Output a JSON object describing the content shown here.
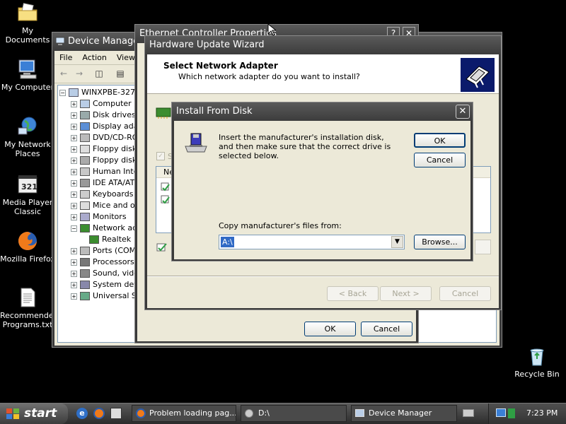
{
  "desktop": {
    "icons": [
      {
        "label": "My Documents"
      },
      {
        "label": "My Computer"
      },
      {
        "label": "My Network Places"
      },
      {
        "label": "Media Player Classic"
      },
      {
        "label": "Mozilla Firefox"
      },
      {
        "label": "Recommended Programs.txt"
      },
      {
        "label": "Recycle Bin"
      }
    ]
  },
  "device_manager": {
    "title": "Device Manager",
    "menu": [
      "File",
      "Action",
      "View"
    ],
    "root": "WINXPBE-327",
    "tree": [
      "Computer",
      "Disk drives",
      "Display ada",
      "DVD/CD-RO",
      "Floppy disk",
      "Floppy disk",
      "Human Inte",
      "IDE ATA/AT",
      "Keyboards",
      "Mice and ot",
      "Monitors",
      "Network ac",
      "Realtek",
      "Ports (COM",
      "Processors",
      "Sound, vide",
      "System dev",
      "Universal S"
    ]
  },
  "properties": {
    "title": "Ethernet Controller Properties",
    "ok_label": "OK",
    "cancel_label": "Cancel"
  },
  "wizard": {
    "title": "Hardware Update Wizard",
    "heading": "Select Network Adapter",
    "subheading": "Which network adapter do you want to install?",
    "list_header": "Ne",
    "show_compat": "S",
    "back_label": "< Back",
    "next_label": "Next >",
    "cancel_label": "Cancel"
  },
  "install_dialog": {
    "title": "Install From Disk",
    "message": "Insert the manufacturer's installation disk, and then make sure that the correct drive is selected below.",
    "ok_label": "OK",
    "cancel_label": "Cancel",
    "copy_label": "Copy manufacturer's files from:",
    "copy_value": "A:\\",
    "browse_label": "Browse..."
  },
  "taskbar": {
    "start_label": "start",
    "tasks": [
      "Problem loading pag...",
      "D:\\",
      "Device Manager"
    ],
    "clock": "7:23 PM"
  },
  "colors": {
    "desktop_bg": "#000000",
    "titlebar": "#4a4a4a",
    "dialog_face": "#ece9d8",
    "button_border": "#003c74",
    "taskbar": "#3b3b3b"
  }
}
